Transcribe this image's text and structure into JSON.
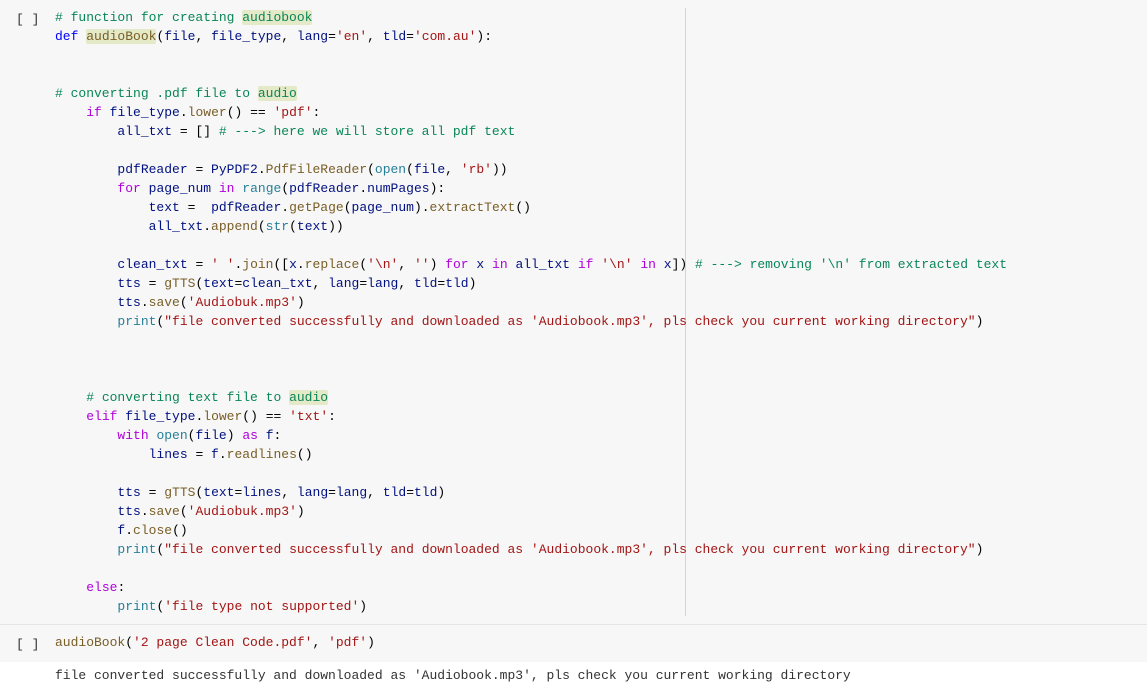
{
  "cells": {
    "gutter1": "[ ]",
    "gutter2": "[ ]",
    "gutter3": "",
    "code1": {
      "l1_comment": "# function for creating ",
      "l1_hl": "audiobook",
      "l2_def": "def",
      "l2_fn": "audioBook",
      "l2_p1": "file",
      "l2_p2": "file_type",
      "l2_p3": "lang",
      "l2_s1": "'en'",
      "l2_p4": "tld",
      "l2_s2": "'com.au'",
      "l4_comment": "# converting .pdf file to ",
      "l4_hl": "audio",
      "l5_if": "if",
      "l5_var": "file_type",
      "l5_fn": "lower",
      "l5_s": "'pdf'",
      "l6_var": "all_txt",
      "l6_comment": "# ---> here we will store all pdf text",
      "l8_var": "pdfReader",
      "l8_mod": "PyPDF2",
      "l8_fn": "PdfFileReader",
      "l8_open": "open",
      "l8_p1": "file",
      "l8_s": "'rb'",
      "l9_for": "for",
      "l9_var": "page_num",
      "l9_in": "in",
      "l9_range": "range",
      "l9_obj": "pdfReader",
      "l9_attr": "numPages",
      "l10_var": "text",
      "l10_obj": "pdfReader",
      "l10_fn1": "getPage",
      "l10_arg": "page_num",
      "l10_fn2": "extractText",
      "l11_obj": "all_txt",
      "l11_fn": "append",
      "l11_str": "str",
      "l11_arg": "text",
      "l13_var": "clean_txt",
      "l13_s1": "' '",
      "l13_fn": "join",
      "l13_x": "x",
      "l13_rep": "replace",
      "l13_s2": "'\\n'",
      "l13_s3": "''",
      "l13_for": "for",
      "l13_in": "in",
      "l13_all": "all_txt",
      "l13_if": "if",
      "l13_in2": "in",
      "l13_comment": "# ---> removing '\\n' from extracted text",
      "l14_var": "tts",
      "l14_cls": "gTTS",
      "l14_p1": "text",
      "l14_v1": "clean_txt",
      "l14_p2": "lang",
      "l14_v2": "lang",
      "l14_p3": "tld",
      "l14_v3": "tld",
      "l15_obj": "tts",
      "l15_fn": "save",
      "l15_s": "'Audiobuk.mp3'",
      "l16_print": "print",
      "l16_s": "\"file converted successfully and downloaded as 'Audiobook.mp3', pls check you current working directory\"",
      "l19_comment": "# converting text file to ",
      "l19_hl": "audio",
      "l20_elif": "elif",
      "l20_var": "file_type",
      "l20_fn": "lower",
      "l20_s": "'txt'",
      "l21_with": "with",
      "l21_open": "open",
      "l21_arg": "file",
      "l21_as": "as",
      "l21_f": "f",
      "l22_var": "lines",
      "l22_obj": "f",
      "l22_fn": "readlines",
      "l24_var": "tts",
      "l24_cls": "gTTS",
      "l24_p1": "text",
      "l24_v1": "lines",
      "l24_p2": "lang",
      "l24_v2": "lang",
      "l24_p3": "tld",
      "l24_v3": "tld",
      "l25_obj": "tts",
      "l25_fn": "save",
      "l25_s": "'Audiobuk.mp3'",
      "l26_obj": "f",
      "l26_fn": "close",
      "l27_print": "print",
      "l27_s": "\"file converted successfully and downloaded as 'Audiobook.mp3', pls check you current working directory\"",
      "l29_else": "else",
      "l30_print": "print",
      "l30_s": "'file type not supported'"
    },
    "code2": {
      "fn": "audioBook",
      "s1": "'2 page Clean Code.pdf'",
      "s2": "'pdf'"
    },
    "output": "file converted successfully and downloaded as 'Audiobook.mp3', pls check you current working directory"
  }
}
